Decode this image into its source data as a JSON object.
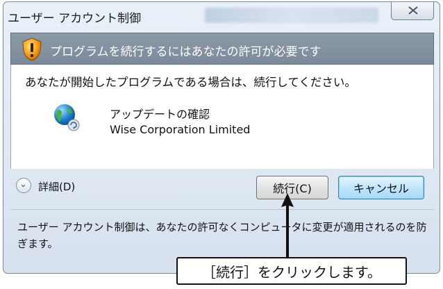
{
  "window": {
    "title": "ユーザー アカウント制御",
    "close_glyph": "✕"
  },
  "banner": {
    "text": "プログラムを続行するにはあなたの許可が必要です",
    "icon": "uac-shield-icon"
  },
  "content": {
    "message": "あなたが開始したプログラムである場合は、続行してください。",
    "app_icon": "globe-update-icon",
    "app_name": "アップデートの確認",
    "publisher": "Wise Corporation Limited"
  },
  "details": {
    "label": "詳細(D)",
    "chevron": "⌄"
  },
  "buttons": {
    "continue": "続行(C)",
    "cancel": "キャンセル"
  },
  "footer": {
    "text": "ユーザー アカウント制御は、あなたの許可なくコンピュータに変更が適用されるのを防ぎます。"
  },
  "annotation": {
    "callout": "［続行］をクリックします。"
  },
  "colors": {
    "banner": "#7b8999",
    "cancel_button": "#bee6fd",
    "frame": "#dfe8f2"
  }
}
